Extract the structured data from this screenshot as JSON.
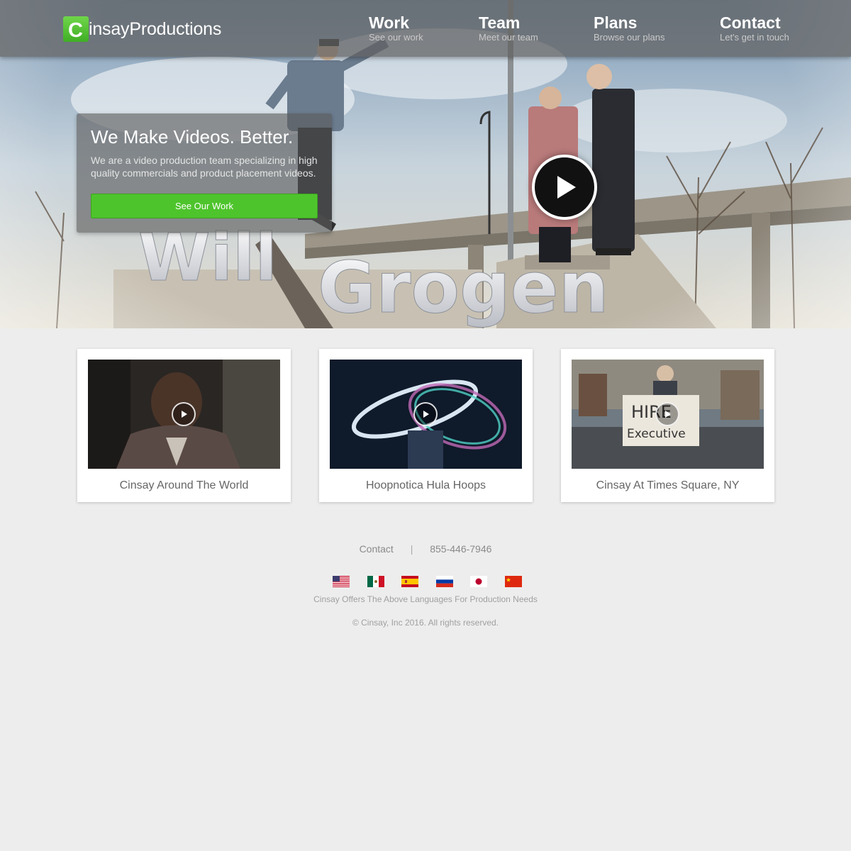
{
  "brand": {
    "logo_letter": "C",
    "name": "insayProductions"
  },
  "nav": [
    {
      "title": "Work",
      "subtitle": "See our work"
    },
    {
      "title": "Team",
      "subtitle": "Meet our team"
    },
    {
      "title": "Plans",
      "subtitle": "Browse our plans"
    },
    {
      "title": "Contact",
      "subtitle": "Let's get in touch"
    }
  ],
  "hero": {
    "title": "We Make Videos. Better.",
    "text": "We are a video production team specializing in high quality commercials and product placement videos.",
    "button": "See Our Work",
    "overlay_word_1": "Will",
    "overlay_word_2": "Grogen"
  },
  "videos": [
    {
      "title": "Cinsay Around The World"
    },
    {
      "title": "Hoopnotica Hula Hoops"
    },
    {
      "title": "Cinsay At Times Square, NY",
      "sign_line_1": "HIRE",
      "sign_line_2": "Executive"
    }
  ],
  "footer": {
    "contact": "Contact",
    "phone": "855-446-7946",
    "languages_note": "Cinsay Offers The Above Languages For Production Needs",
    "copyright": "© Cinsay, Inc 2016. All rights reserved."
  },
  "flags": [
    "flag-usa-icon",
    "flag-mexico-icon",
    "flag-spain-icon",
    "flag-russia-icon",
    "flag-japan-icon",
    "flag-china-icon"
  ],
  "colors": {
    "accent": "#4ec42c",
    "header": "#5f5f5f",
    "background": "#ededed"
  }
}
